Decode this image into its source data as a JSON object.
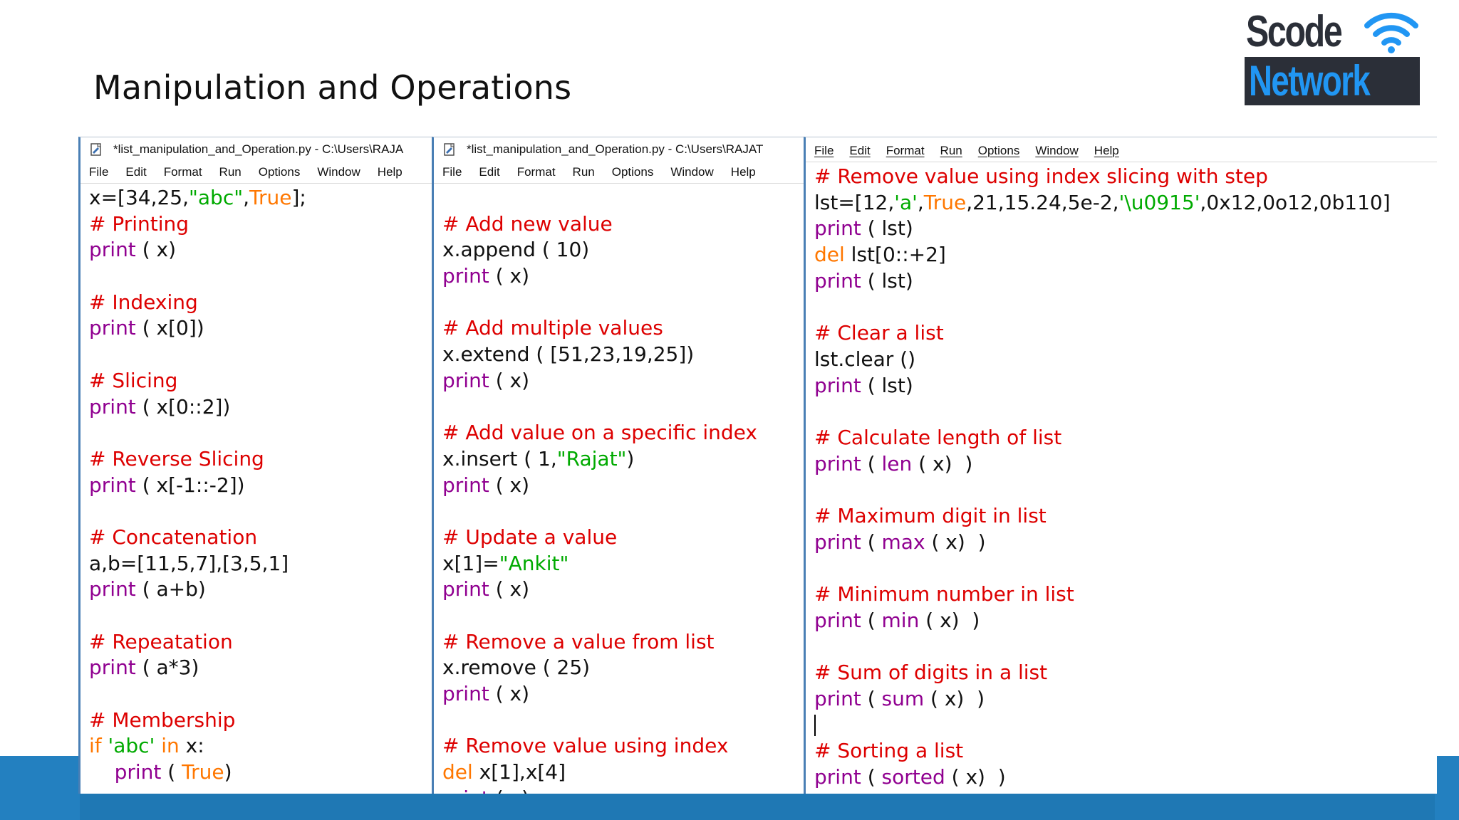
{
  "slide": {
    "title": "Manipulation and Operations"
  },
  "logo": {
    "line1": "Scode",
    "line2": "Network"
  },
  "windows": [
    {
      "title": "*list_manipulation_and_Operation.py - C:\\Users\\RAJA",
      "menu": [
        "File",
        "Edit",
        "Format",
        "Run",
        "Options",
        "Window",
        "Help"
      ]
    },
    {
      "title": "*list_manipulation_and_Operation.py - C:\\Users\\RAJAT",
      "menu": [
        "File",
        "Edit",
        "Format",
        "Run",
        "Options",
        "Window",
        "Help"
      ]
    },
    {
      "title": "",
      "menu": [
        "File",
        "Edit",
        "Format",
        "Run",
        "Options",
        "Window",
        "Help"
      ]
    }
  ],
  "code": {
    "pane1": [
      [
        [
          "t",
          "x=[34,25,"
        ],
        [
          "st",
          "\"abc\""
        ],
        [
          "t",
          ","
        ],
        [
          "kw",
          "True"
        ],
        [
          "t",
          "];"
        ]
      ],
      [
        [
          "cm",
          "# Printing"
        ]
      ],
      [
        [
          "bi",
          "print"
        ],
        [
          "t",
          " ( x)"
        ]
      ],
      [],
      [
        [
          "cm",
          "# Indexing"
        ]
      ],
      [
        [
          "bi",
          "print"
        ],
        [
          "t",
          " ( x[0])"
        ]
      ],
      [],
      [
        [
          "cm",
          "# Slicing"
        ]
      ],
      [
        [
          "bi",
          "print"
        ],
        [
          "t",
          " ( x[0::2])"
        ]
      ],
      [],
      [
        [
          "cm",
          "# Reverse Slicing"
        ]
      ],
      [
        [
          "bi",
          "print"
        ],
        [
          "t",
          " ( x[-1::-2])"
        ]
      ],
      [],
      [
        [
          "cm",
          "# Concatenation"
        ]
      ],
      [
        [
          "t",
          "a,b=[11,5,7],[3,5,1]"
        ]
      ],
      [
        [
          "bi",
          "print"
        ],
        [
          "t",
          " ( a+b)"
        ]
      ],
      [],
      [
        [
          "cm",
          "# Repeatation"
        ]
      ],
      [
        [
          "bi",
          "print"
        ],
        [
          "t",
          " ( a*3)"
        ]
      ],
      [],
      [
        [
          "cm",
          "# Membership"
        ]
      ],
      [
        [
          "kw",
          "if"
        ],
        [
          "t",
          " "
        ],
        [
          "st",
          "'abc'"
        ],
        [
          "t",
          " "
        ],
        [
          "kw",
          "in"
        ],
        [
          "t",
          " x:"
        ]
      ],
      [
        [
          "t",
          "    "
        ],
        [
          "bi",
          "print"
        ],
        [
          "t",
          " ( "
        ],
        [
          "kw",
          "True"
        ],
        [
          "t",
          ")"
        ]
      ]
    ],
    "pane2": [
      [],
      [
        [
          "cm",
          "# Add new value"
        ]
      ],
      [
        [
          "t",
          "x.append ( 10)"
        ]
      ],
      [
        [
          "bi",
          "print"
        ],
        [
          "t",
          " ( x)"
        ]
      ],
      [],
      [
        [
          "cm",
          "# Add multiple values"
        ]
      ],
      [
        [
          "t",
          "x.extend ( [51,23,19,25])"
        ]
      ],
      [
        [
          "bi",
          "print"
        ],
        [
          "t",
          " ( x)"
        ]
      ],
      [],
      [
        [
          "cm",
          "# Add value on a specific index"
        ]
      ],
      [
        [
          "t",
          "x.insert ( 1,"
        ],
        [
          "st",
          "\"Rajat\""
        ],
        [
          "t",
          ")"
        ]
      ],
      [
        [
          "bi",
          "print"
        ],
        [
          "t",
          " ( x)"
        ]
      ],
      [],
      [
        [
          "cm",
          "# Update a value"
        ]
      ],
      [
        [
          "t",
          "x[1]="
        ],
        [
          "st",
          "\"Ankit\""
        ]
      ],
      [
        [
          "bi",
          "print"
        ],
        [
          "t",
          " ( x)"
        ]
      ],
      [],
      [
        [
          "cm",
          "# Remove a value from list"
        ]
      ],
      [
        [
          "t",
          "x.remove ( 25)"
        ]
      ],
      [
        [
          "bi",
          "print"
        ],
        [
          "t",
          " ( x)"
        ]
      ],
      [],
      [
        [
          "cm",
          "# Remove value using index"
        ]
      ],
      [
        [
          "kw",
          "del"
        ],
        [
          "t",
          " x[1],x[4]"
        ]
      ],
      [
        [
          "bi",
          "print"
        ],
        [
          "t",
          " ( x)"
        ]
      ]
    ],
    "pane3": [
      [
        [
          "cm",
          "# Remove value using index slicing with step"
        ]
      ],
      [
        [
          "t",
          "lst=[12,"
        ],
        [
          "st",
          "'a'"
        ],
        [
          "t",
          ","
        ],
        [
          "kw",
          "True"
        ],
        [
          "t",
          ",21,15.24,5e-2,"
        ],
        [
          "st",
          "'\\u0915'"
        ],
        [
          "t",
          ",0x12,0o12,0b110]"
        ]
      ],
      [
        [
          "bi",
          "print"
        ],
        [
          "t",
          " ( lst)"
        ]
      ],
      [
        [
          "kw",
          "del"
        ],
        [
          "t",
          " lst[0::+2]"
        ]
      ],
      [
        [
          "bi",
          "print"
        ],
        [
          "t",
          " ( lst)"
        ]
      ],
      [],
      [
        [
          "cm",
          "# Clear a list"
        ]
      ],
      [
        [
          "t",
          "lst.clear ()"
        ]
      ],
      [
        [
          "bi",
          "print"
        ],
        [
          "t",
          " ( lst)"
        ]
      ],
      [],
      [
        [
          "cm",
          "# Calculate length of list"
        ]
      ],
      [
        [
          "bi",
          "print"
        ],
        [
          "t",
          " ( "
        ],
        [
          "bi",
          "len"
        ],
        [
          "t",
          " ( x)  )"
        ]
      ],
      [],
      [
        [
          "cm",
          "# Maximum digit in list"
        ]
      ],
      [
        [
          "bi",
          "print"
        ],
        [
          "t",
          " ( "
        ],
        [
          "bi",
          "max"
        ],
        [
          "t",
          " ( x)  )"
        ]
      ],
      [],
      [
        [
          "cm",
          "# Minimum number in list"
        ]
      ],
      [
        [
          "bi",
          "print"
        ],
        [
          "t",
          " ( "
        ],
        [
          "bi",
          "min"
        ],
        [
          "t",
          " ( x)  )"
        ]
      ],
      [],
      [
        [
          "cm",
          "# Sum of digits in a list"
        ]
      ],
      [
        [
          "bi",
          "print"
        ],
        [
          "t",
          " ( "
        ],
        [
          "bi",
          "sum"
        ],
        [
          "t",
          " ( x)  )"
        ]
      ],
      [],
      [
        [
          "cm",
          "# Sorting a list"
        ]
      ],
      [
        [
          "bi",
          "print"
        ],
        [
          "t",
          " ( "
        ],
        [
          "bi",
          "sorted"
        ],
        [
          "t",
          " ( x)  )"
        ]
      ]
    ]
  },
  "colors": {
    "comment": "#dd0000",
    "keyword": "#ff7700",
    "builtin": "#900090",
    "string": "#00aa00",
    "band": "#1f78b4"
  }
}
